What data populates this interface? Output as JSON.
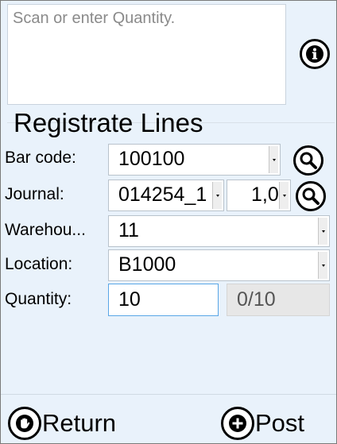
{
  "message": {
    "placeholder": "Scan or enter Quantity."
  },
  "icons": {
    "info": "info-icon",
    "search": "magnifier-icon",
    "return": "stop-hand-icon",
    "post": "plus-circle-icon",
    "dropdown": "dropdown-arrow-icon"
  },
  "form": {
    "title": "Registrate Lines",
    "barcode": {
      "label": "Bar code:",
      "value": "100100"
    },
    "journal": {
      "label": "Journal:",
      "value": "014254_1",
      "version": "1,0"
    },
    "warehouse": {
      "label": "Warehou...",
      "value": "11"
    },
    "location": {
      "label": "Location:",
      "value": "B1000"
    },
    "quantity": {
      "label": "Quantity:",
      "value": "10",
      "progress": "0/10"
    }
  },
  "actions": {
    "return_label": "Return",
    "post_label": "Post"
  },
  "colors": {
    "background": "#e9f2fb",
    "field": "#ffffff",
    "focus_border": "#59a6e6",
    "readonly": "#e7e7e7"
  }
}
